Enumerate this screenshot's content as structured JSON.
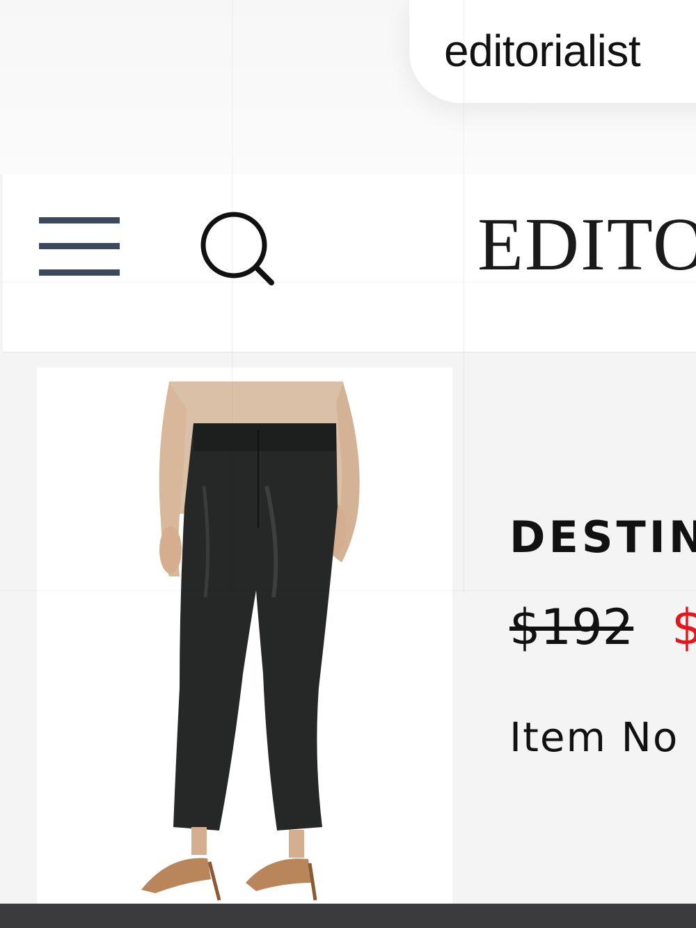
{
  "browser": {
    "url_text": "editorialist"
  },
  "header": {
    "logo_text": "EDITO",
    "menu_icon": "hamburger-menu-icon",
    "search_icon": "search-icon",
    "menu_color": "#3a4a5c"
  },
  "product": {
    "image_description_icon": "product-photo",
    "name": "DESTIN",
    "original_price": "$192",
    "sale_price": "$",
    "sale_color": "#e8141b",
    "item_label": "Item No"
  },
  "footer": {
    "bar_color": "#3b3b3d"
  }
}
